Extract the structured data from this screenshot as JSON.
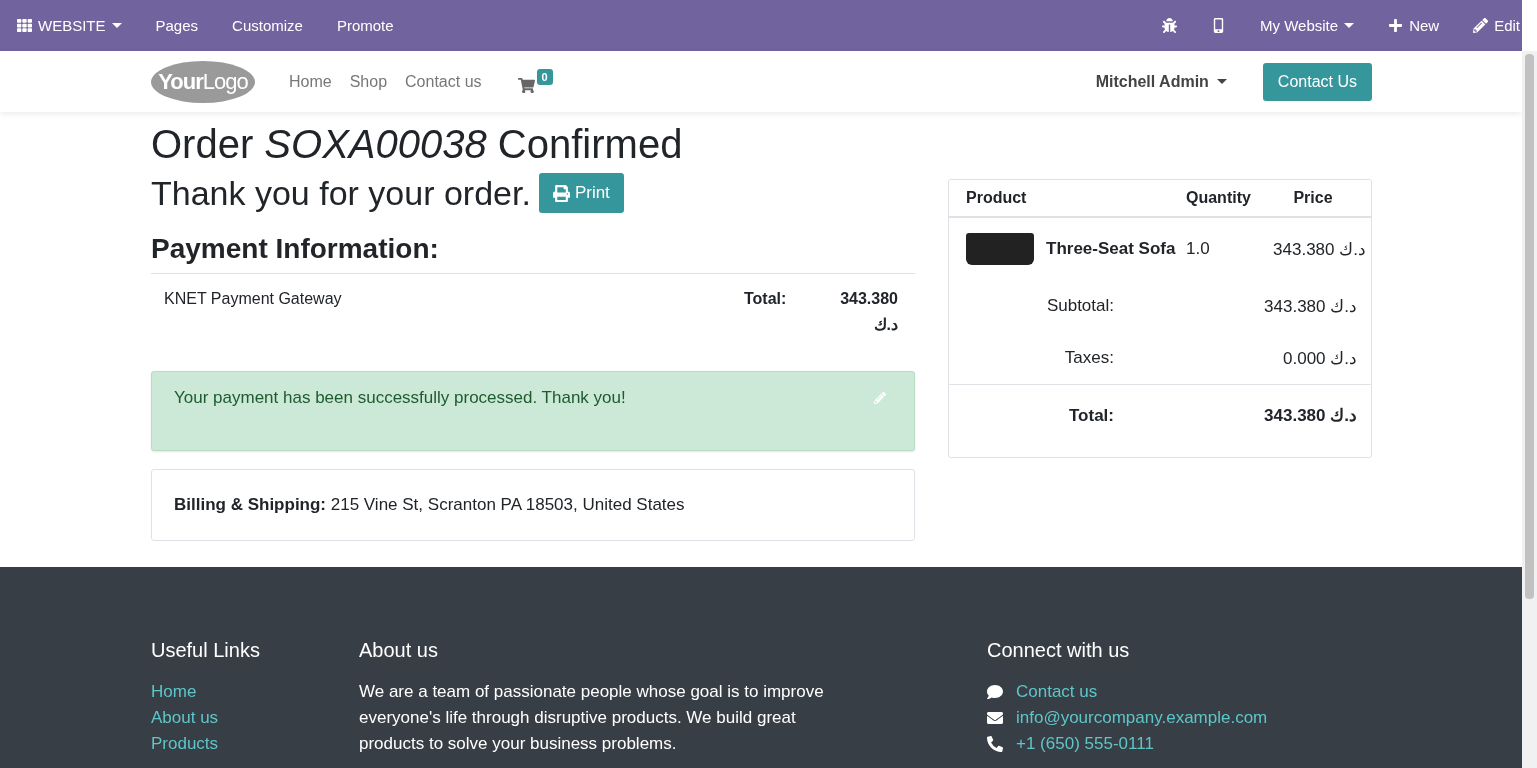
{
  "admin_bar": {
    "app_menu": "WEBSITE",
    "menu": [
      "Pages",
      "Customize",
      "Promote"
    ],
    "website_switcher": "My Website",
    "new_button": "New",
    "edit_button": "Edit"
  },
  "header": {
    "logo": "**Your**Logo",
    "nav": [
      "Home",
      "Shop",
      "Contact us"
    ],
    "cart_count": "0",
    "user": "Mitchell Admin",
    "cta": "Contact Us"
  },
  "order": {
    "title": "Order *SOXA00038* Confirmed",
    "thanks": "Thank you for your order.",
    "print": "Print",
    "payment_heading": "Payment Information:",
    "method": "KNET Payment Gateway",
    "total_label": "Total:",
    "total_value": "343.380 د.ك",
    "alert": "Your payment has been successfully processed. Thank you!",
    "billing": "**Billing & Shipping:** 215 Vine St, Scranton PA 18503, United States"
  },
  "summary": {
    "columns": [
      "Product",
      "Quantity",
      "Price"
    ],
    "lines": [
      {
        "name": "Three-Seat Sofa",
        "quantity": "1.0",
        "price": "343.380 د.ك"
      }
    ],
    "totals": [
      {
        "kind": "sub",
        "label": "Subtotal:",
        "value": "343.380 د.ك"
      },
      {
        "kind": "sub",
        "label": "Taxes:",
        "value": "0.000 د.ك"
      },
      {
        "kind": "grand",
        "label": "Total:",
        "value": "343.380 د.ك"
      }
    ]
  },
  "footer": {
    "links_heading": "Useful Links",
    "links": [
      "Home",
      "About us",
      "Products"
    ],
    "about_heading": "About us",
    "about_text": "We are a team of passionate people whose goal is to improve everyone's life through disruptive products. We build great products to solve your business problems.",
    "connect_heading": "Connect with us",
    "contacts": [
      {
        "kind": "chat",
        "text": "Contact us"
      },
      {
        "kind": "mail",
        "text": "info@yourcompany.example.com"
      },
      {
        "kind": "phone",
        "text": "+1 (650) 555-0111"
      }
    ]
  }
}
